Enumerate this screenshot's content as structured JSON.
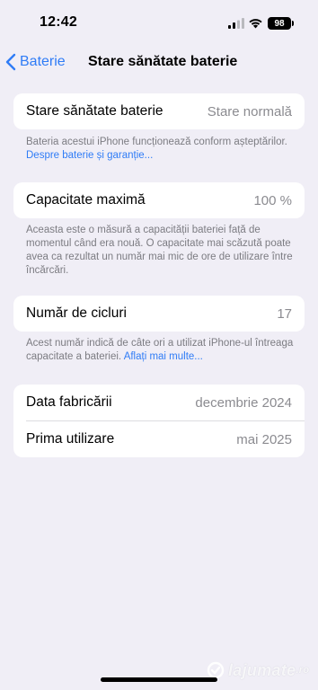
{
  "status_bar": {
    "time": "12:42",
    "battery_level": "98",
    "icons": [
      "signal-icon",
      "wifi-icon",
      "battery-icon"
    ]
  },
  "nav": {
    "back_label": "Baterie",
    "title": "Stare sănătate baterie"
  },
  "sections": {
    "health": {
      "label": "Stare sănătate baterie",
      "value": "Stare normală",
      "footnote_text": "Bateria acestui iPhone funcționează conform așteptărilor. ",
      "footnote_link": "Despre baterie și garanție..."
    },
    "capacity": {
      "label": "Capacitate maximă",
      "value": "100 %",
      "footnote_text": "Aceasta este o măsură a capacității bateriei față de momentul când era nouă. O capacitate mai scăzută poate avea ca rezultat un număr mai mic de ore de utilizare între încărcări."
    },
    "cycles": {
      "label": "Număr de cicluri",
      "value": "17",
      "footnote_text": "Acest număr indică de câte ori a utilizat iPhone-ul întreaga capacitate a bateriei. ",
      "footnote_link": "Aflați mai multe..."
    },
    "dates": {
      "manufacture_label": "Data fabricării",
      "manufacture_value": "decembrie 2024",
      "first_use_label": "Prima utilizare",
      "first_use_value": "mai 2025"
    }
  },
  "watermark": {
    "text": "lajumate",
    "tld": ".ro"
  },
  "colors": {
    "accent": "#2f7cf6",
    "background": "#f0eef6",
    "secondary_text": "#8b8b90"
  }
}
